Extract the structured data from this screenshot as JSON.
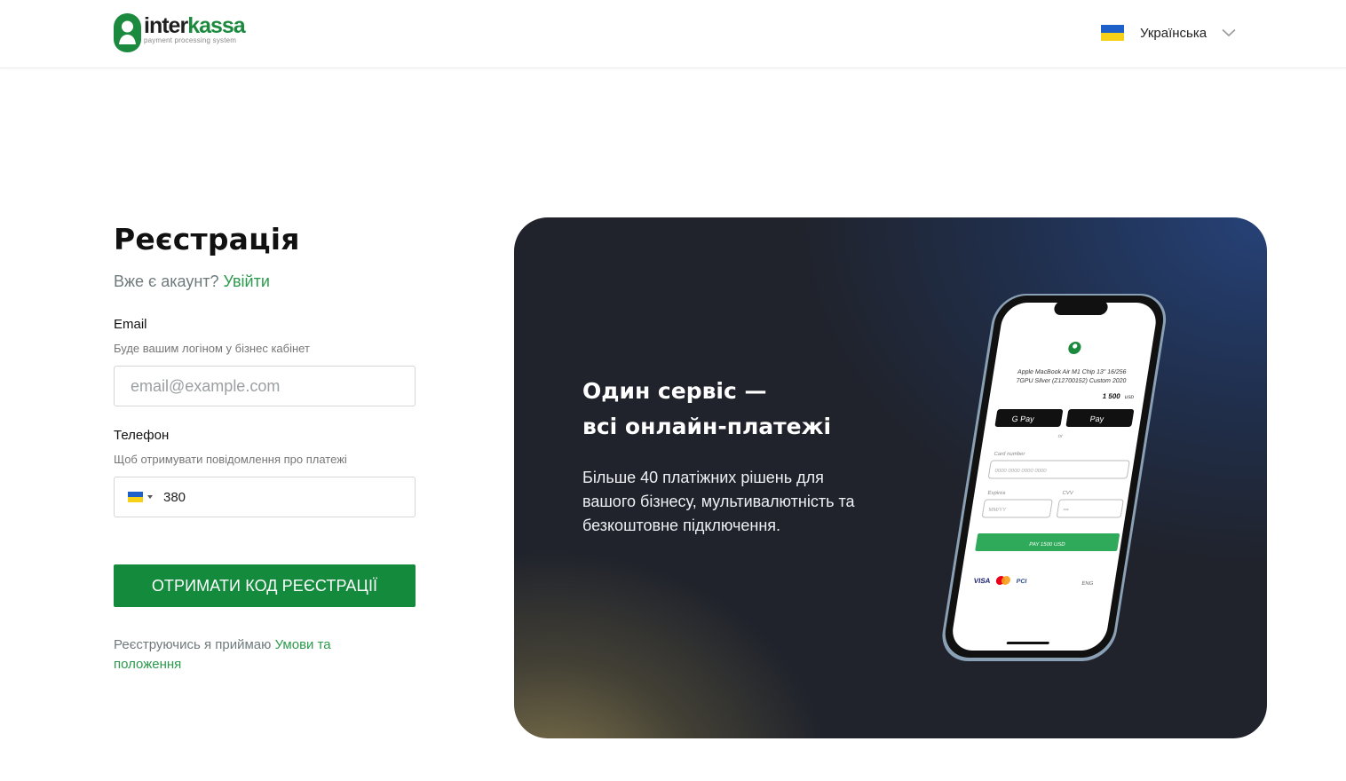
{
  "header": {
    "logo": {
      "word_a": "inter",
      "word_b": "kassa",
      "tagline": "payment processing system"
    },
    "language": {
      "label": "Українська",
      "flag": "ukraine-flag"
    }
  },
  "form": {
    "title": "Реєстрація",
    "has_account": "Вже є акаунт?",
    "login_link": "Увійти",
    "email": {
      "label": "Email",
      "hint": "Буде вашим логіном у бізнес кабінет",
      "placeholder": "email@example.com",
      "value": ""
    },
    "phone": {
      "label": "Телефон",
      "hint": "Щоб отримувати повідомлення про платежі",
      "country_flag": "ukraine-flag",
      "value": "380"
    },
    "submit_label": "ОТРИМАТИ КОД РЕЄСТРАЦІЇ",
    "terms_prefix": "Реєструючись я приймаю",
    "terms_link": "Умови та положення"
  },
  "promo": {
    "title_line1": "Один сервіс —",
    "title_line2": "всі онлайн-платежі",
    "text": "Більше 40 платіжних рішень для вашого бізнесу, мультивалютність та безкоштовне підключення.",
    "phone_mockup": {
      "product": "Apple MacBook Air M1 Chip 13\" 16/256",
      "product_line2": "7GPU Silver (Z12700152) Custom 2020",
      "price": "1 500",
      "currency": "USD",
      "gpay": "G Pay",
      "applepay": "Pay",
      "or": "or",
      "card_label": "Card number",
      "card_placeholder": "0000 0000 0000 0000",
      "expires_label": "Expires",
      "expires_placeholder": "MM/YY",
      "cvv_label": "CVV",
      "cvv_placeholder": "•••",
      "pay_button": "PAY 1500 USD",
      "lang": "ENG"
    }
  },
  "colors": {
    "brand_green": "#138a3c",
    "link_green": "#2b9a4b",
    "promo_bg": "#20232c"
  }
}
